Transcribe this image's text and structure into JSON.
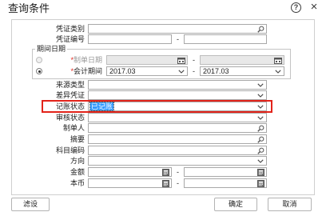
{
  "dialog": {
    "title": "查询条件",
    "help_glyph": "?",
    "close_glyph": "×"
  },
  "icons": {
    "help": "question-circle-icon",
    "close": "close-icon",
    "lookup": "search-icon",
    "date": "calendar-icon",
    "number": "calculator-icon",
    "dropdown": "chevron-down-icon"
  },
  "form": {
    "separator": "-",
    "voucher_type": {
      "label": "凭证类别",
      "value": ""
    },
    "voucher_number": {
      "label": "凭证编号",
      "from": "",
      "to": ""
    },
    "period": {
      "legend": "期间日期",
      "required_mark": "*",
      "create_date": {
        "label": "制单日期",
        "selected": false,
        "enabled": false,
        "from": "",
        "to": ""
      },
      "accounting_period": {
        "label": "会计期间",
        "selected": true,
        "from": "2017.03",
        "to": "2017.03"
      }
    },
    "source_type": {
      "label": "来源类型",
      "value": ""
    },
    "diff_voucher": {
      "label": "差异凭证",
      "value": ""
    },
    "posting_status": {
      "label": "记账状态",
      "value": "已记账"
    },
    "audit_status": {
      "label": "审核状态",
      "value": ""
    },
    "creator": {
      "label": "制单人",
      "value": ""
    },
    "summary": {
      "label": "摘要",
      "value": ""
    },
    "account_code": {
      "label": "科目编码",
      "value": ""
    },
    "direction": {
      "label": "方向",
      "value": ""
    },
    "amount": {
      "label": "金额",
      "from": "",
      "to": ""
    },
    "local_currency": {
      "label": "本币",
      "from": "",
      "to": ""
    }
  },
  "footer": {
    "filter_settings_label": "滤设",
    "ok_label": "确定",
    "cancel_label": "取消"
  },
  "colors": {
    "selection": "#3399ff",
    "annotation": "#e2231a",
    "required_mark": "#e2231a",
    "disabled_field": "#e8e8e8",
    "field_border": "#a8a8a8"
  }
}
